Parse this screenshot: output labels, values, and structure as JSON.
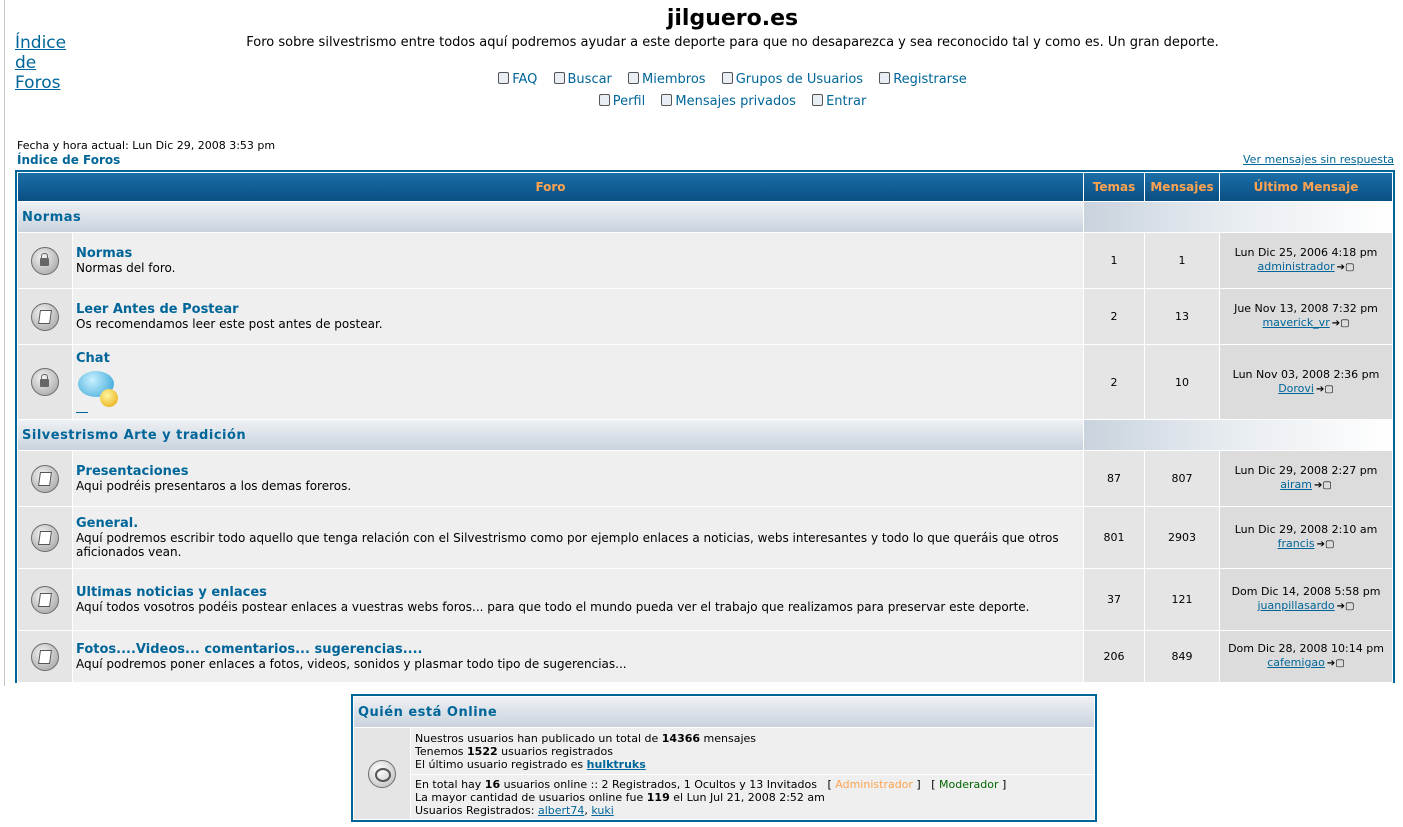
{
  "header": {
    "home_link": "Índice de Foros",
    "site_title": "jilguero.es",
    "description": "Foro sobre silvestrismo entre todos aquí podremos ayudar a este deporte para que no desaparezca y sea reconocido tal y como es. Un gran deporte.",
    "nav_row1": [
      "FAQ",
      "Buscar",
      "Miembros",
      "Grupos de Usuarios",
      "Registrarse"
    ],
    "nav_row2": [
      "Perfil",
      "Mensajes privados",
      "Entrar"
    ]
  },
  "info": {
    "datetime": "Fecha y hora actual: Lun Dic 29, 2008 3:53 pm",
    "breadcrumb": "Índice de Foros",
    "unanswered": "Ver mensajes sin respuesta"
  },
  "table_headers": {
    "forum": "Foro",
    "topics": "Temas",
    "posts": "Mensajes",
    "last": "Último Mensaje"
  },
  "categories": [
    {
      "name": "Normas",
      "forums": [
        {
          "name": "Normas",
          "desc": "Normas del foro.",
          "topics": "1",
          "posts": "1",
          "last_date": "Lun Dic 25, 2006 4:18 pm",
          "last_user": "administrador",
          "locked": true
        },
        {
          "name": "Leer Antes de Postear",
          "desc": "Os recomendamos leer este post antes de postear.",
          "topics": "2",
          "posts": "13",
          "last_date": "Jue Nov 13, 2008 7:32 pm",
          "last_user": "maverick_vr",
          "locked": false
        },
        {
          "name": "Chat",
          "desc": "",
          "topics": "2",
          "posts": "10",
          "last_date": "Lun Nov 03, 2008 2:36 pm",
          "last_user": "Dorovi",
          "locked": true
        }
      ]
    },
    {
      "name": "Silvestrismo Arte y tradición",
      "forums": [
        {
          "name": "Presentaciones",
          "desc": "Aqui podréis presentaros a los demas foreros.",
          "topics": "87",
          "posts": "807",
          "last_date": "Lun Dic 29, 2008 2:27 pm",
          "last_user": "airam"
        },
        {
          "name": "General.",
          "desc": "Aquí podremos escribir todo aquello que tenga relación con el Silvestrismo como por ejemplo enlaces a noticias, webs interesantes y todo lo que queráis que otros aficionados vean.",
          "topics": "801",
          "posts": "2903",
          "last_date": "Lun Dic 29, 2008 2:10 am",
          "last_user": "francis"
        },
        {
          "name": "Ultimas noticias y enlaces",
          "desc": "Aquí todos vosotros podéis postear enlaces a vuestras webs foros... para que todo el mundo pueda ver el trabajo que realizamos para preservar este deporte.",
          "topics": "37",
          "posts": "121",
          "last_date": "Dom Dic 14, 2008 5:58 pm",
          "last_user": "juanpillasardo"
        },
        {
          "name": "Fotos....Videos... comentarios... sugerencias....",
          "desc": "Aquí podremos poner enlaces a fotos, videos, sonidos y plasmar todo tipo de sugerencias...",
          "topics": "206",
          "posts": "849",
          "last_date": "Dom Dic 28, 2008 10:14 pm",
          "last_user": "cafemigao"
        }
      ]
    }
  ],
  "online": {
    "title": "Quién está Online",
    "l1a": "Nuestros usuarios han publicado un total de ",
    "l1b": "14366",
    "l1c": " mensajes",
    "l2a": "Tenemos ",
    "l2b": "1522",
    "l2c": " usuarios registrados",
    "l3a": "El último usuario registrado es ",
    "l3b": "hulktruks",
    "l4a": "En total hay ",
    "l4b": "16",
    "l4c": " usuarios online :: 2 Registrados, 1 Ocultos y 13 Invitados",
    "admin": "Administrador",
    "mod": "Moderador",
    "l5a": "La mayor cantidad de usuarios online fue ",
    "l5b": "119",
    "l5c": " el Lun Jul 21, 2008 2:52 am",
    "l6a": "Usuarios Registrados: ",
    "user1": "albert74",
    "sep": ", ",
    "user2": "kuki"
  }
}
